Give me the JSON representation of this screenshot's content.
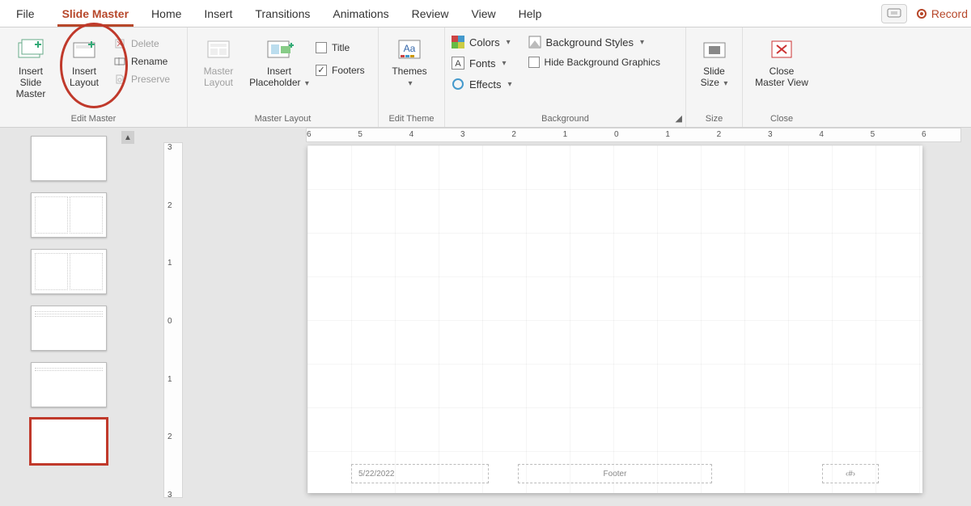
{
  "tabs": {
    "file": "File",
    "slide_master": "Slide Master",
    "home": "Home",
    "insert": "Insert",
    "transitions": "Transitions",
    "animations": "Animations",
    "review": "Review",
    "view": "View",
    "help": "Help"
  },
  "title_right": {
    "record": "Record"
  },
  "ribbon": {
    "edit_master": {
      "insert_slide_master": "Insert Slide\nMaster",
      "insert_layout": "Insert\nLayout",
      "delete": "Delete",
      "rename": "Rename",
      "preserve": "Preserve",
      "group_label": "Edit Master"
    },
    "master_layout": {
      "master_layout": "Master\nLayout",
      "insert_placeholder": "Insert\nPlaceholder",
      "title": "Title",
      "footers": "Footers",
      "group_label": "Master Layout"
    },
    "edit_theme": {
      "themes": "Themes",
      "group_label": "Edit Theme"
    },
    "background": {
      "colors": "Colors",
      "fonts": "Fonts",
      "effects": "Effects",
      "bg_styles": "Background Styles",
      "hide_bg": "Hide Background Graphics",
      "group_label": "Background"
    },
    "size": {
      "slide_size": "Slide\nSize",
      "group_label": "Size"
    },
    "close": {
      "close_master": "Close\nMaster View",
      "group_label": "Close"
    }
  },
  "hruler_marks": [
    "6",
    "5",
    "4",
    "3",
    "2",
    "1",
    "0",
    "1",
    "2",
    "3",
    "4",
    "5",
    "6"
  ],
  "vruler_marks": [
    "3",
    "2",
    "1",
    "0",
    "1",
    "2",
    "3"
  ],
  "slide": {
    "date": "5/22/2022",
    "footer": "Footer",
    "number": "‹#›"
  }
}
